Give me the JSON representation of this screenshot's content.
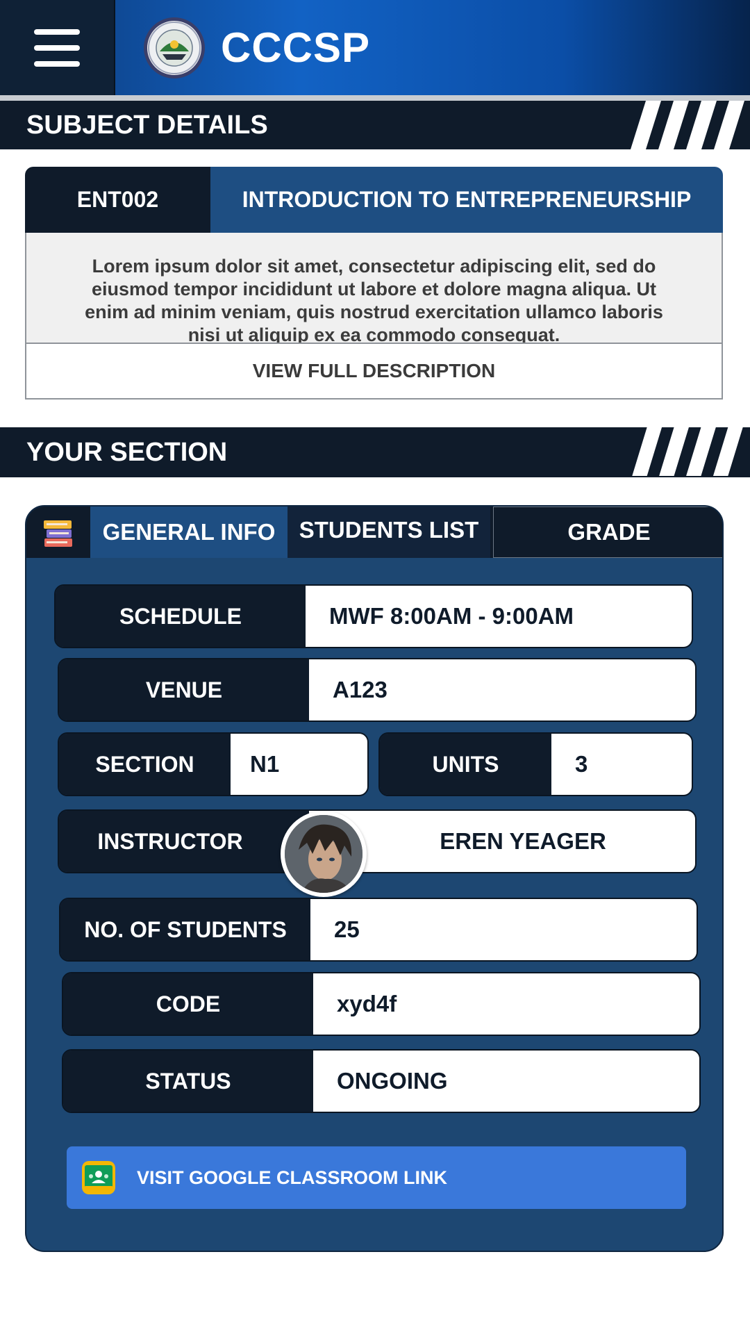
{
  "app": {
    "title": "CCCSP",
    "logo_icon": "college-seal-logo",
    "menu_icon": "hamburger-menu-icon"
  },
  "subject_details": {
    "header": "SUBJECT DETAILS",
    "code": "ENT002",
    "name": "INTRODUCTION TO ENTREPRENEURSHIP",
    "description": "Lorem ipsum dolor sit amet, consectetur adipiscing elit, sed do eiusmod tempor incididunt ut labore et dolore magna aliqua. Ut enim ad minim veniam, quis nostrud exercitation ullamco laboris nisi ut aliquip ex ea commodo consequat.",
    "view_full_label": "VIEW FULL DESCRIPTION"
  },
  "your_section": {
    "header": "YOUR SECTION",
    "tabs": [
      {
        "label": "GENERAL INFO",
        "active": true
      },
      {
        "label": "STUDENTS LIST",
        "active": false
      },
      {
        "label": "GRADE",
        "active": false
      }
    ],
    "fields": {
      "schedule": {
        "label": "SCHEDULE",
        "value": "MWF 8:00AM - 9:00AM"
      },
      "venue": {
        "label": "VENUE",
        "value": "A123"
      },
      "section": {
        "label": "SECTION",
        "value": "N1"
      },
      "units": {
        "label": "UNITS",
        "value": "3"
      },
      "instructor": {
        "label": "INSTRUCTOR",
        "value": "EREN YEAGER"
      },
      "students": {
        "label": "NO. OF STUDENTS",
        "value": "25"
      },
      "code": {
        "label": "CODE",
        "value": "xyd4f"
      },
      "status": {
        "label": "STATUS",
        "value": "ONGOING"
      }
    },
    "classroom_button": "VISIT GOOGLE CLASSROOM LINK"
  },
  "colors": {
    "navy": "#0f1b2a",
    "card_blue": "#1d4772",
    "tab_active": "#1e4e82",
    "button_blue": "#3a78da",
    "appbar_blue": "#1262c4"
  }
}
